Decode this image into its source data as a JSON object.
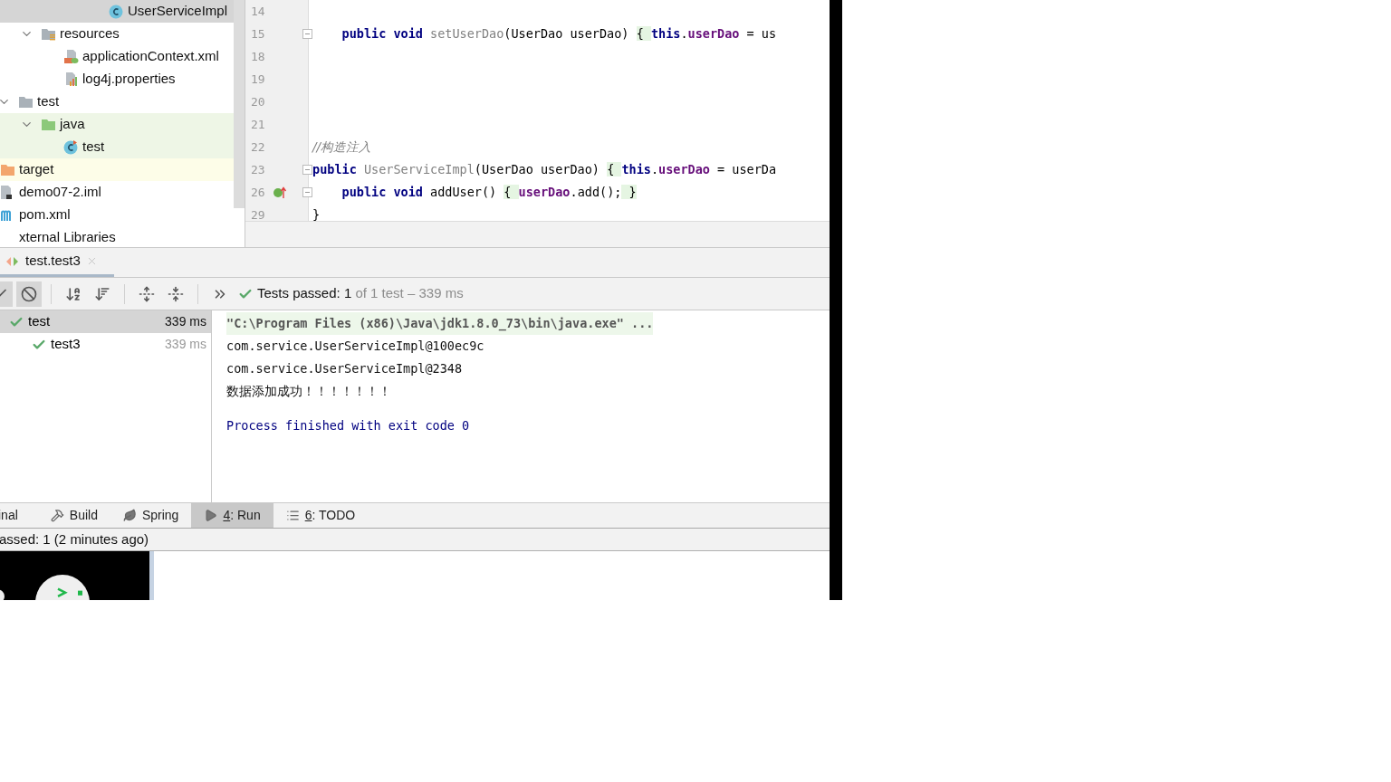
{
  "project_tree": [
    {
      "children": [
        {
          "children": [
            {
              "children": [
                {
                  "children": [
                    {
                      "children": [
                        {
                          "children": [
                            {
                              "label": "UserServiceImpl",
                              "kind": "class",
                              "selected": true
                            }
                          ]
                        }
                      ]
                    }
                  ]
                },
                {
                  "label": "resources",
                  "kind": "resources-folder",
                  "expanded": true,
                  "selected": false,
                  "children": [
                    {
                      "label": "applicationContext.xml",
                      "kind": "spring-xml",
                      "selected": false
                    },
                    {
                      "label": "log4j.properties",
                      "kind": "properties",
                      "selected": false
                    }
                  ]
                }
              ]
            },
            {
              "label": "test",
              "kind": "folder",
              "expanded": true,
              "selected": false,
              "children": [
                {
                  "label": "java",
                  "kind": "test-folder",
                  "expanded": true,
                  "color": "#eef6e6",
                  "selected": false,
                  "children": [
                    {
                      "label": "test",
                      "kind": "test-class",
                      "color": "#eef6e6",
                      "selected": false
                    }
                  ]
                }
              ]
            }
          ]
        },
        {
          "label": "target",
          "kind": "target-folder",
          "color": "#fdfde8",
          "selected": false
        },
        {
          "label": "demo07-2.iml",
          "kind": "iml",
          "selected": false
        },
        {
          "label": "pom.xml",
          "kind": "maven",
          "selected": false
        }
      ]
    },
    {
      "label": "xternal Libraries",
      "selected": false
    }
  ],
  "editor": {
    "lines": [
      {
        "number": "14"
      },
      {
        "number": "15",
        "markers": [
          {
            "kind": "fold"
          }
        ],
        "tokens": [
          {
            "text": "    public void ",
            "kind": "keyword"
          },
          {
            "text": "setUserDao",
            "kind": "unused"
          },
          {
            "text": "(UserDao userDao) ",
            "kind": "plain"
          },
          {
            "text": "{ ",
            "kind": "brace"
          },
          {
            "text": "this",
            "kind": "keyword"
          },
          {
            "text": ".",
            "kind": "plain"
          },
          {
            "text": "userDao",
            "kind": "field"
          },
          {
            "text": " = us",
            "kind": "plain"
          }
        ]
      },
      {
        "number": "18"
      },
      {
        "number": "19"
      },
      {
        "number": "20"
      },
      {
        "number": "21"
      },
      {
        "number": "22",
        "tokens": [
          {
            "text": "//构造注入",
            "kind": "comment"
          }
        ]
      },
      {
        "number": "23",
        "markers": [
          {
            "kind": "fold"
          }
        ],
        "tokens": [
          {
            "text": "public ",
            "kind": "keyword"
          },
          {
            "text": "UserServiceImpl",
            "kind": "unused"
          },
          {
            "text": "(UserDao userDao) ",
            "kind": "plain"
          },
          {
            "text": "{ ",
            "kind": "brace"
          },
          {
            "text": "this",
            "kind": "keyword"
          },
          {
            "text": ".",
            "kind": "plain"
          },
          {
            "text": "userDao",
            "kind": "field"
          },
          {
            "text": " = userDa",
            "kind": "plain"
          }
        ]
      },
      {
        "number": "26",
        "markers": [
          {
            "kind": "implements"
          },
          {
            "kind": "fold"
          }
        ],
        "tokens": [
          {
            "text": "    public void ",
            "kind": "keyword"
          },
          {
            "text": "addUser() ",
            "kind": "plain"
          },
          {
            "text": "{ ",
            "kind": "brace"
          },
          {
            "text": "userDao",
            "kind": "field"
          },
          {
            "text": ".add();",
            "kind": "plain"
          },
          {
            "text": " }",
            "kind": "brace"
          }
        ]
      },
      {
        "number": "29",
        "tokens": [
          {
            "text": "}",
            "kind": "plain"
          }
        ]
      }
    ]
  },
  "run_tab": {
    "label": "test.test3"
  },
  "toolbar": [
    {
      "kind": "show-passed",
      "pressed": true
    },
    {
      "kind": "show-ignored",
      "pressed": true
    },
    {
      "kind": "sort-alpha",
      "pressed": false
    },
    {
      "kind": "sort-duration",
      "pressed": false
    },
    {
      "kind": "expand-all",
      "pressed": false
    },
    {
      "kind": "collapse-all",
      "pressed": false
    },
    {
      "kind": "more",
      "pressed": false
    }
  ],
  "test_status": {
    "passed": true,
    "main": "Tests passed: 1",
    "detail": " of 1 test – 339 ms"
  },
  "test_tree": [
    {
      "label": "test",
      "time": "339 ms",
      "passed": true,
      "selected": true,
      "children": [
        {
          "label": "test3",
          "time": "339 ms",
          "passed": true,
          "selected": false
        }
      ]
    }
  ],
  "console": [
    {
      "kind": "command",
      "text": "\"C:\\Program Files (x86)\\Java\\jdk1.8.0_73\\bin\\java.exe\" ..."
    },
    {
      "kind": "output",
      "text": "com.service.UserServiceImpl@100ec9c"
    },
    {
      "kind": "output",
      "text": "com.service.UserServiceImpl@2348"
    },
    {
      "kind": "output-cjk",
      "text": "数据添加成功！！！！！！！"
    },
    {
      "kind": "exit",
      "text": "Process finished with exit code 0"
    }
  ],
  "tool_tabs": [
    {
      "kind": "terminal",
      "label": "inal",
      "selected": false
    },
    {
      "kind": "build",
      "label": "Build",
      "selected": false
    },
    {
      "kind": "spring",
      "label": "Spring",
      "selected": false
    },
    {
      "kind": "run",
      "mnemonic": "4",
      "label": ": Run",
      "selected": true
    },
    {
      "kind": "todo",
      "mnemonic": "6",
      "label": ": TODO",
      "selected": false
    }
  ],
  "status_bar": {
    "text": "assed: 1 (2 minutes ago)"
  }
}
